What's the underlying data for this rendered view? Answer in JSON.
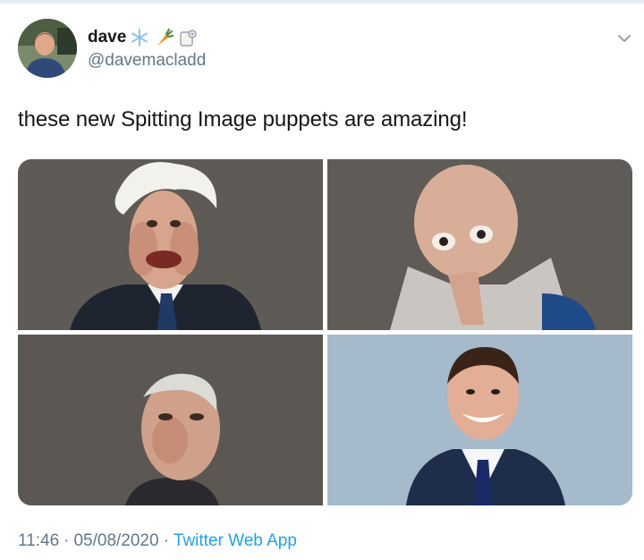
{
  "tweet": {
    "display_name": "dave",
    "handle": "@davemacladd",
    "text": "these new Spitting Image puppets are amazing!",
    "time": "11:46",
    "date": "05/08/2020",
    "source": "Twitter Web App",
    "separator": "·"
  },
  "icons": [
    "snowflake-emoji-icon",
    "carrot-emoji-icon",
    "toilet-paper-emoji-icon",
    "chevron-down-icon"
  ],
  "colors": {
    "link": "#1da1f2",
    "secondary_text": "#657786",
    "primary_text": "#14171a"
  }
}
